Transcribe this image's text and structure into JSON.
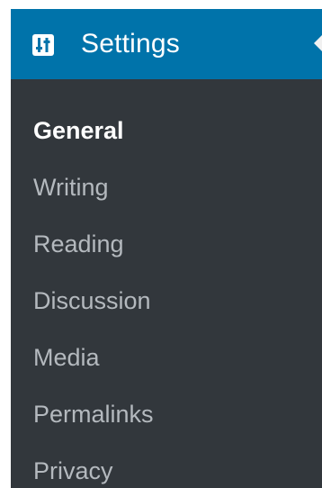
{
  "menu": {
    "title": "Settings",
    "icon": "settings-sliders-icon",
    "colors": {
      "header_bg": "#0073aa",
      "menu_bg": "#32373c",
      "item_text": "#b4b9be",
      "current_text": "#ffffff"
    },
    "items": [
      {
        "label": "General",
        "current": true
      },
      {
        "label": "Writing",
        "current": false
      },
      {
        "label": "Reading",
        "current": false
      },
      {
        "label": "Discussion",
        "current": false
      },
      {
        "label": "Media",
        "current": false
      },
      {
        "label": "Permalinks",
        "current": false
      },
      {
        "label": "Privacy",
        "current": false
      }
    ]
  }
}
